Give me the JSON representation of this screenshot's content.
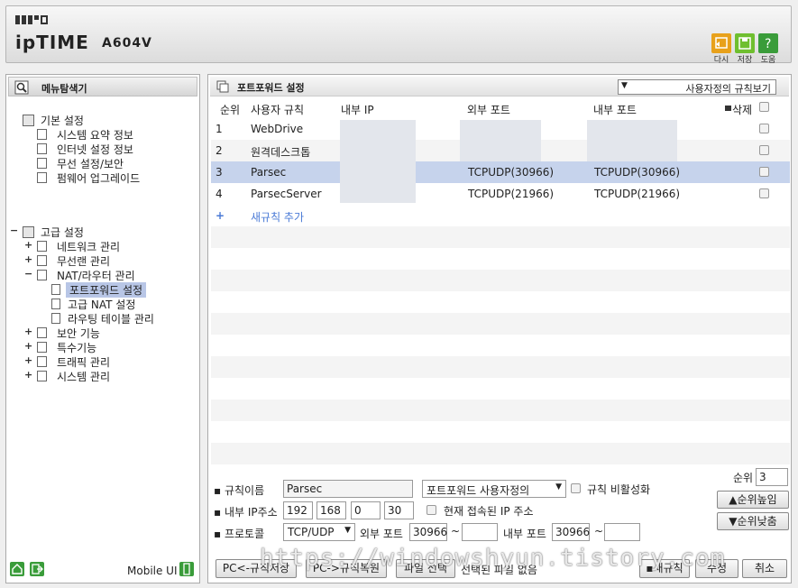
{
  "header": {
    "brand": "ipTIME",
    "model": "A604V",
    "buttons": [
      {
        "label": "다시",
        "icon": "undo-icon",
        "color": "#e8a11b"
      },
      {
        "label": "저장",
        "icon": "save-icon",
        "color": "#6fbf2f"
      },
      {
        "label": "도움",
        "icon": "help-icon",
        "color": "#3a9c3a"
      }
    ]
  },
  "sidebar": {
    "title": "메뉴탐색기",
    "basic": {
      "label": "기본 설정",
      "items": [
        "시스템 요약 정보",
        "인터넷 설정 정보",
        "무선 설정/보안",
        "펌웨어 업그레이드"
      ]
    },
    "advanced": {
      "label": "고급 설정",
      "groups": [
        "네트워크 관리",
        "무선랜 관리",
        "NAT/라우터 관리",
        "보안 기능",
        "특수기능",
        "트래픽 관리",
        "시스템 관리"
      ],
      "nat_items": [
        "포트포워드 설정",
        "고급 NAT 설정",
        "라우팅 테이블 관리"
      ]
    },
    "footer_label": "Mobile UI"
  },
  "main": {
    "title": "포트포워드 설정",
    "view_select": "사용자정의 규칙보기",
    "columns": [
      "순위",
      "사용자 규칙",
      "내부 IP",
      "외부 포트",
      "내부 포트",
      "삭제"
    ],
    "rows": [
      {
        "rank": "1",
        "name": "WebDrive",
        "ext": "",
        "int": ""
      },
      {
        "rank": "2",
        "name": "원격데스크톱",
        "ext": "",
        "int": ""
      },
      {
        "rank": "3",
        "name": "Parsec",
        "ext": "TCPUDP(30966)",
        "int": "TCPUDP(30966)"
      },
      {
        "rank": "4",
        "name": "ParsecServer",
        "ext": "TCPUDP(21966)",
        "int": "TCPUDP(21966)"
      }
    ],
    "add_rule": "새규칙 추가"
  },
  "form": {
    "rule_name_label": "규칙이름",
    "rule_name": "Parsec",
    "preset": "포트포워드 사용자정의",
    "disable_label": "규칙 비활성화",
    "ip_label": "내부 IP주소",
    "ip": [
      "192",
      "168",
      "0",
      "30"
    ],
    "current_ip_label": "현재 접속된 IP 주소",
    "protocol_label": "프로토콜",
    "protocol": "TCP/UDP",
    "ext_port_label": "외부 포트",
    "ext_port_from": "30966",
    "ext_port_to": "",
    "int_port_label": "내부 포트",
    "int_port_from": "30966",
    "int_port_to": "",
    "tilde": "~",
    "rank_label": "순위",
    "rank": "3",
    "rank_up": "순위높임",
    "rank_down": "순위낮춤"
  },
  "footer_buttons": [
    "PC<-규칙저장",
    "PC->규칙복원",
    "파일 선택",
    "선택된 파일 없음",
    "새규칙",
    "수정",
    "취소"
  ],
  "watermark": "https://windowshyun.tistory.com"
}
